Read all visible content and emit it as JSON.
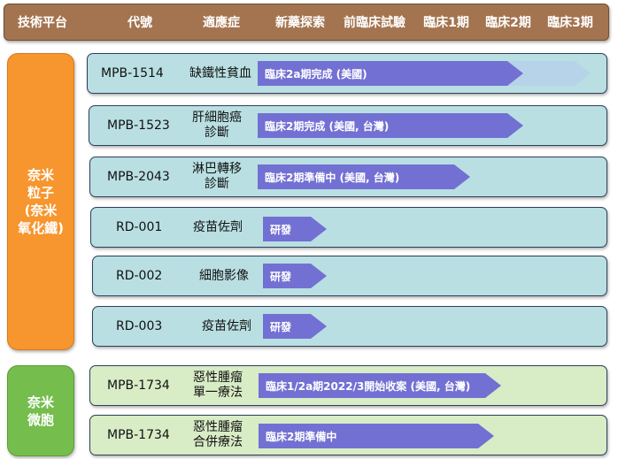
{
  "header": {
    "columns": [
      "技術平台",
      "代號",
      "適應症",
      "新藥探索",
      "前臨床試驗",
      "臨床1期",
      "臨床2期",
      "臨床3期"
    ]
  },
  "platforms": {
    "nano": "奈米\n粒子\n(奈米\n氧化鐵)",
    "micro": "奈米\n微胞"
  },
  "rows": [
    {
      "code": "MPB-1514",
      "indication": "缺鐵性貧血",
      "status": "臨床2a期完成 (美國)",
      "platform": "nano"
    },
    {
      "code": "MPB-1523",
      "indication": "肝細胞癌\n診斷",
      "status": "臨床2期完成 (美國, 台灣)",
      "platform": "nano"
    },
    {
      "code": "MPB-2043",
      "indication": "淋巴轉移\n診斷",
      "status": "臨床2期準備中 (美國, 台灣)",
      "platform": "nano"
    },
    {
      "code": "RD-001",
      "indication": "疫苗佐劑",
      "status": "研發",
      "platform": "nano"
    },
    {
      "code": "RD-002",
      "indication": "細胞影像",
      "status": "研發",
      "platform": "nano"
    },
    {
      "code": "RD-003",
      "indication": "疫苗佐劑",
      "status": "研發",
      "platform": "nano"
    },
    {
      "code": "MPB-1734",
      "indication": "惡性腫瘤\n單一療法",
      "status": "臨床1/2a期2022/3開始收案 (美國, 台灣)",
      "platform": "micro"
    },
    {
      "code": "MPB-1734",
      "indication": "惡性腫瘤\n合併療法",
      "status": "臨床2期準備中",
      "platform": "micro"
    }
  ],
  "colors": {
    "arrow": "#7370d3",
    "arrow_ghost": "#b7c8ee"
  }
}
